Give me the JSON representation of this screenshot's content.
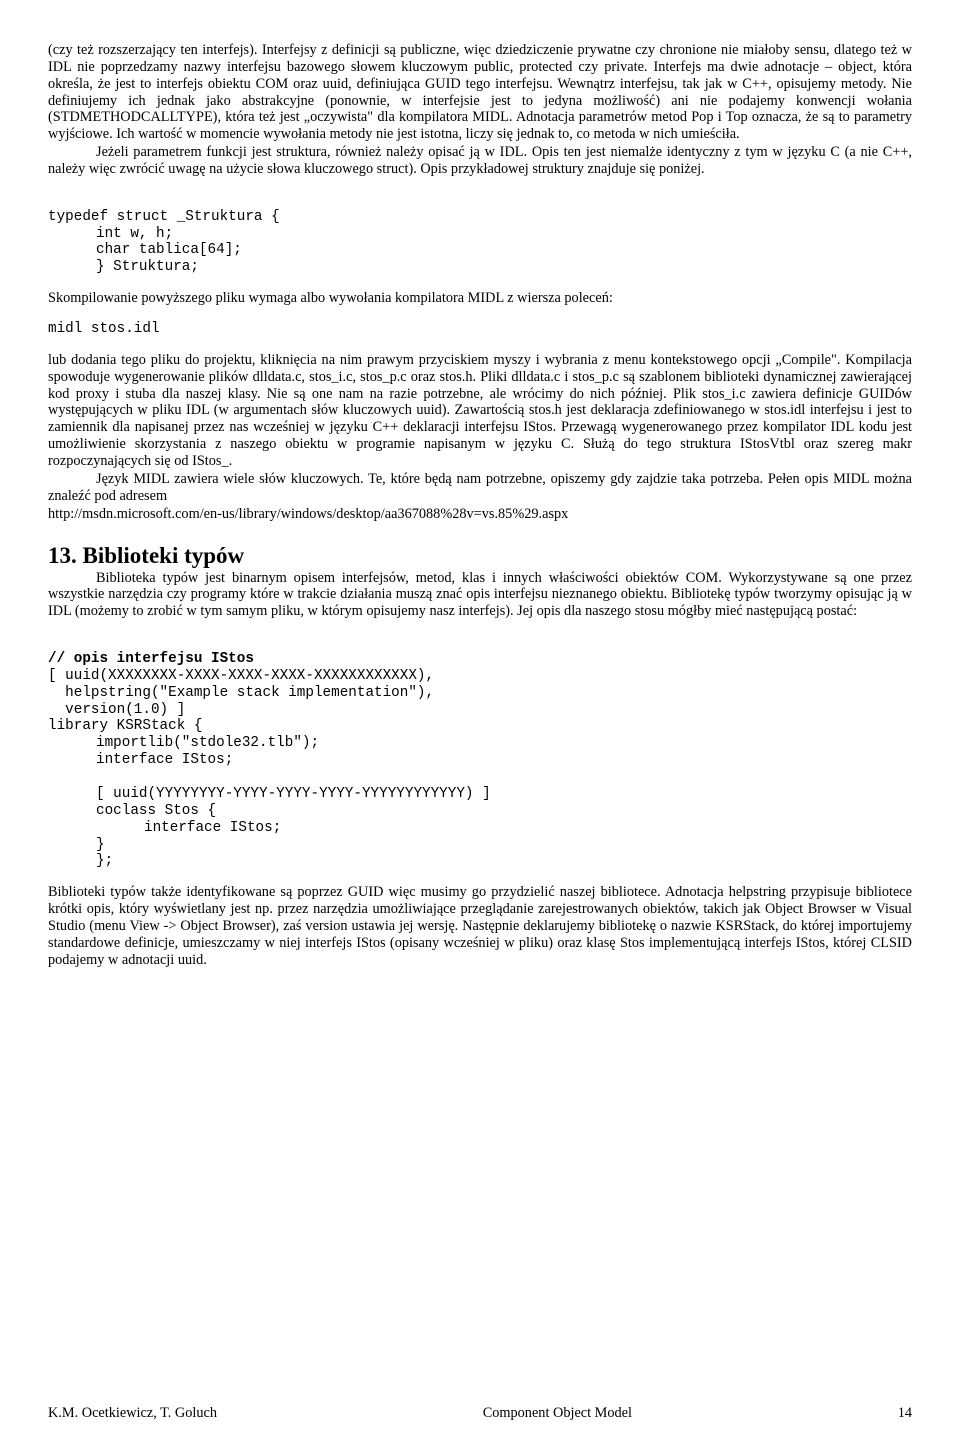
{
  "p1": "(czy też rozszerzający ten interfejs). Interfejsy z definicji są publiczne, więc dziedziczenie prywatne czy chronione nie miałoby sensu, dlatego też w IDL nie poprzedzamy nazwy interfejsu bazowego słowem kluczowym public, protected czy private. Interfejs ma dwie adnotacje – object, która określa, że jest to interfejs obiektu COM oraz uuid, definiująca GUID tego interfejsu. Wewnątrz interfejsu, tak jak w C++, opisujemy metody. Nie definiujemy ich jednak jako abstrakcyjne (ponownie, w interfejsie jest to jedyna możliwość) ani nie podajemy konwencji wołania (STDMETHODCALLTYPE), która też jest „oczywista\" dla kompilatora MIDL. Adnotacja parametrów metod Pop i Top oznacza, że są to parametry wyjściowe. Ich wartość w momencie wywołania metody nie jest istotna, liczy się jednak to, co metoda w nich umieściła.",
  "p2": "Jeżeli parametrem funkcji jest struktura, również należy opisać ją w IDL. Opis ten jest niemalże identyczny z tym w języku C (a nie C++, należy więc zwrócić uwagę na użycie słowa kluczowego struct). Opis przykładowej struktury znajduje się poniżej.",
  "code1_l1": "typedef struct _Struktura {",
  "code1_l2": "int w, h;",
  "code1_l3": "char tablica[64];",
  "code1_l4": "} Struktura;",
  "p3": "Skompilowanie powyższego pliku wymaga albo wywołania kompilatora MIDL z wiersza poleceń:",
  "code2": "midl stos.idl",
  "p4": "lub dodania tego pliku do projektu, kliknięcia na nim prawym przyciskiem myszy i wybrania z menu kontekstowego opcji „Compile\". Kompilacja spowoduje wygenerowanie plików dlldata.c, stos_i.c, stos_p.c oraz stos.h. Pliki dlldata.c i stos_p.c są szablonem biblioteki dynamicznej zawierającej kod proxy i stuba dla naszej klasy. Nie są one nam na razie potrzebne, ale wrócimy do nich później. Plik stos_i.c zawiera definicje GUIDów występujących w pliku IDL (w argumentach słów kluczowych uuid). Zawartością stos.h jest deklaracja zdefiniowanego w stos.idl interfejsu i jest to zamiennik dla napisanej przez nas wcześniej w języku C++ deklaracji interfejsu IStos. Przewagą wygenerowanego przez kompilator IDL kodu jest umożliwienie skorzystania z naszego obiektu w programie napisanym w języku C. Służą do tego struktura IStosVtbl oraz szereg makr rozpoczynających się od IStos_.",
  "p5": "Język MIDL zawiera wiele słów kluczowych. Te, które będą nam potrzebne, opiszemy gdy zajdzie taka potrzeba. Pełen opis MIDL można znaleźć pod adresem",
  "url": "http://msdn.microsoft.com/en-us/library/windows/desktop/aa367088%28v=vs.85%29.aspx",
  "heading": "13. Biblioteki typów",
  "p6": "Biblioteka typów jest binarnym opisem interfejsów, metod, klas i innych właściwości obiektów COM. Wykorzystywane są one przez wszystkie narzędzia czy programy które w trakcie działania muszą znać opis interfejsu nieznanego obiektu. Bibliotekę typów tworzymy opisując ją w IDL (możemy to zrobić w tym samym pliku, w którym opisujemy nasz interfejs). Jej opis dla naszego stosu mógłby mieć następującą postać:",
  "code3_l1": "// opis interfejsu IStos",
  "code3_l2": "[ uuid(XXXXXXXX-XXXX-XXXX-XXXX-XXXXXXXXXXXX),",
  "code3_l3": "  helpstring(\"Example stack implementation\"),",
  "code3_l4": "  version(1.0) ]",
  "code3_l5": "library KSRStack {",
  "code3_l6": "importlib(\"stdole32.tlb\");",
  "code3_l7": "interface IStos;",
  "code3_l8": "[ uuid(YYYYYYYY-YYYY-YYYY-YYYY-YYYYYYYYYYYY) ]",
  "code3_l9": "coclass Stos {",
  "code3_l10": "interface IStos;",
  "code3_l11": "}",
  "code3_l12": "};",
  "p7": "Biblioteki typów także identyfikowane są poprzez GUID więc musimy go przydzielić naszej bibliotece. Adnotacja helpstring przypisuje bibliotece krótki opis, który wyświetlany jest np. przez narzędzia umożliwiające przeglądanie zarejestrowanych obiektów, takich jak Object Browser w Visual Studio (menu View -> Object Browser), zaś version ustawia jej wersję. Następnie deklarujemy bibliotekę o nazwie KSRStack, do której importujemy standardowe definicje, umieszczamy w niej interfejs IStos (opisany wcześniej w pliku) oraz klasę Stos implementującą interfejs IStos, której CLSID podajemy w adnotacji uuid.",
  "footer_left": "K.M. Ocetkiewicz, T. Goluch",
  "footer_center": "Component Object Model",
  "footer_right": "14"
}
